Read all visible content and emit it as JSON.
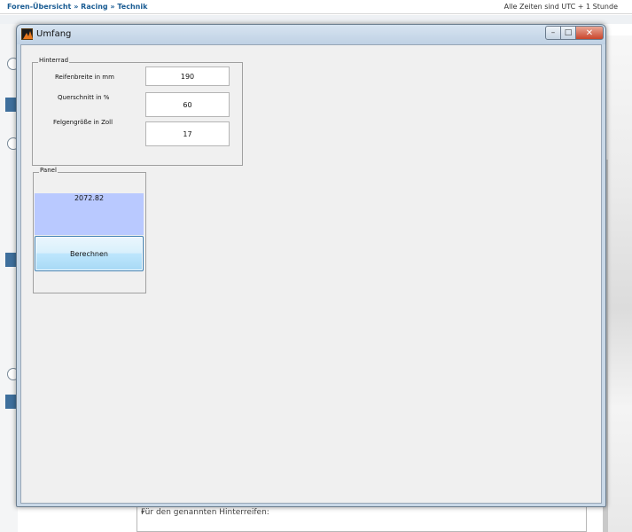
{
  "background": {
    "breadcrumb": [
      "Foren-Übersicht",
      "Racing",
      "Technik"
    ],
    "breadcrumb_separator": "»",
    "timezone": "Alle Zeiten sind UTC + 1 Stunde",
    "reply_textarea_text": "Für den genannten Hinterreifen:"
  },
  "window": {
    "title": "Umfang",
    "controls": {
      "minimize": "–",
      "maximize": "□",
      "close": "✕"
    }
  },
  "hinterrad": {
    "label": "Hinterrad",
    "fields": [
      {
        "label": "Reifenbreite in mm",
        "value": "190"
      },
      {
        "label": "Querschnitt in %",
        "value": "60"
      },
      {
        "label": "Felgengröße in Zoll",
        "value": "17"
      }
    ]
  },
  "panel": {
    "label": "Panel",
    "result": "2072.82",
    "button_label": "Berechnen"
  },
  "colors": {
    "result_bg": "#b9c9ff",
    "button_border": "#3c7fb1",
    "close_button": "#c9452b",
    "breadcrumb_link": "#1a5c93"
  }
}
